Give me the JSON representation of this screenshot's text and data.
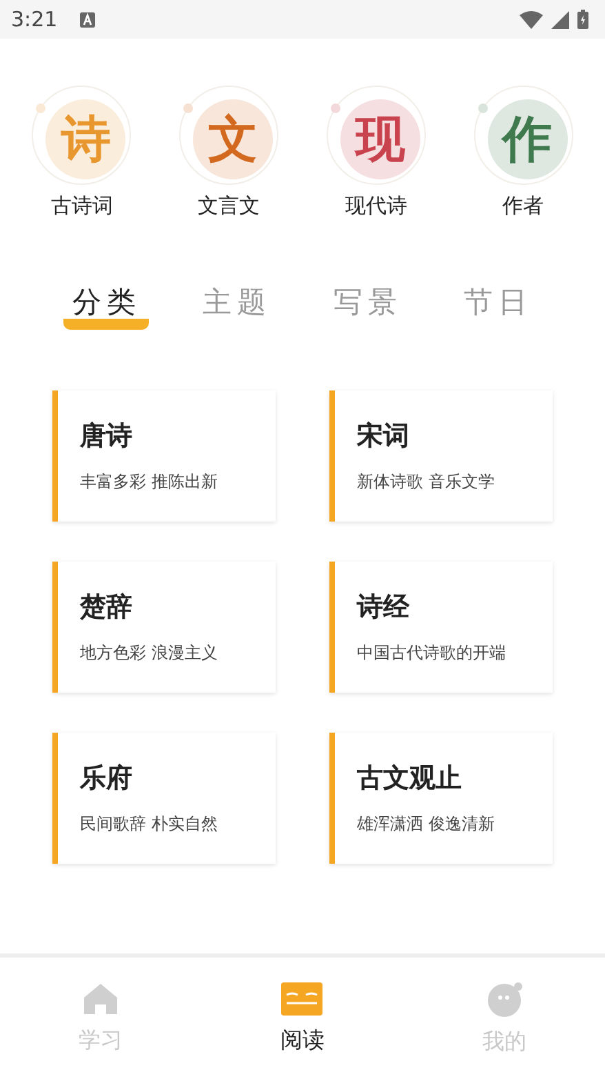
{
  "status_bar": {
    "time": "3:21"
  },
  "categories": [
    {
      "glyph": "诗",
      "label": "古诗词",
      "color": "#e8962e"
    },
    {
      "glyph": "文",
      "label": "文言文",
      "color": "#d2691e"
    },
    {
      "glyph": "现",
      "label": "现代诗",
      "color": "#c9434f"
    },
    {
      "glyph": "作",
      "label": "作者",
      "color": "#3f7a4f"
    }
  ],
  "tabs": [
    {
      "label": "分类",
      "selected": true
    },
    {
      "label": "主题",
      "selected": false
    },
    {
      "label": "写景",
      "selected": false
    },
    {
      "label": "节日",
      "selected": false
    }
  ],
  "cards": [
    {
      "title": "唐诗",
      "subtitle": "丰富多彩 推陈出新"
    },
    {
      "title": "宋词",
      "subtitle": "新体诗歌 音乐文学"
    },
    {
      "title": "楚辞",
      "subtitle": "地方色彩 浪漫主义"
    },
    {
      "title": "诗经",
      "subtitle": "中国古代诗歌的开端"
    },
    {
      "title": "乐府",
      "subtitle": "民间歌辞 朴实自然"
    },
    {
      "title": "古文观止",
      "subtitle": "雄浑潇洒 俊逸清新"
    }
  ],
  "nav": [
    {
      "label": "学习",
      "kind": "home",
      "selected": false
    },
    {
      "label": "阅读",
      "kind": "book",
      "selected": true
    },
    {
      "label": "我的",
      "kind": "face",
      "selected": false
    }
  ]
}
